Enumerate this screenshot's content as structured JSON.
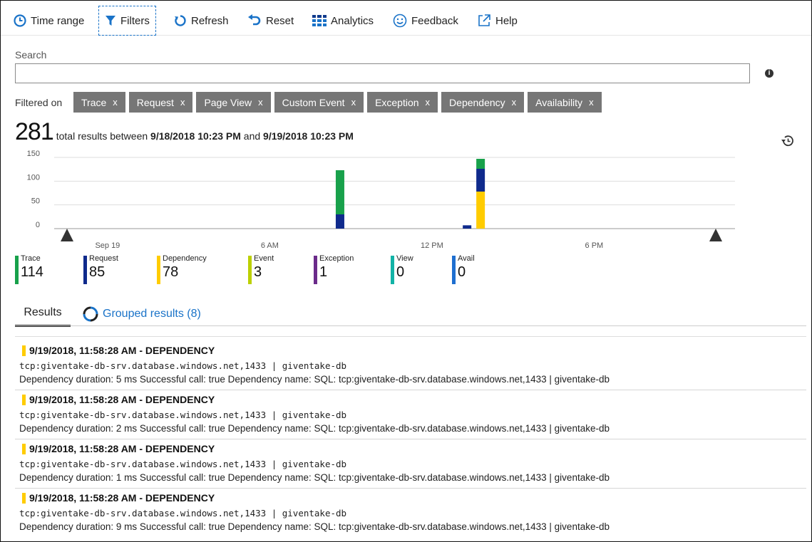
{
  "toolbar": {
    "time_range": "Time range",
    "filters": "Filters",
    "refresh": "Refresh",
    "reset": "Reset",
    "analytics": "Analytics",
    "feedback": "Feedback",
    "help": "Help"
  },
  "search": {
    "label": "Search",
    "value": ""
  },
  "filters": {
    "label": "Filtered on",
    "chips": [
      "Trace",
      "Request",
      "Page View",
      "Custom Event",
      "Exception",
      "Dependency",
      "Availability"
    ],
    "remove_glyph": "x"
  },
  "summary": {
    "count": "281",
    "text_before": "total results between",
    "start": "9/18/2018 10:23 PM",
    "and": "and",
    "end": "9/19/2018 10:23 PM"
  },
  "chart_data": {
    "type": "bar",
    "stacked": true,
    "y_ticks": [
      "150",
      "100",
      "50",
      "0"
    ],
    "ylim": [
      0,
      150
    ],
    "x_labels": [
      "Sep 19",
      "6 AM",
      "12 PM",
      "6 PM"
    ],
    "bars": [
      {
        "time_hours": 8.6,
        "segments": [
          {
            "series": "Request",
            "value": 30
          },
          {
            "series": "Trace",
            "value": 93
          }
        ]
      },
      {
        "time_hours": 13.3,
        "segments": [
          {
            "series": "Request",
            "value": 7
          }
        ]
      },
      {
        "time_hours": 13.8,
        "segments": [
          {
            "series": "Dependency",
            "value": 78
          },
          {
            "series": "Request",
            "value": 48
          },
          {
            "series": "Trace",
            "value": 21
          }
        ]
      }
    ],
    "colors": {
      "Trace": "#18a14b",
      "Request": "#0f2a8c",
      "Dependency": "#ffcc00",
      "Event": "#bcd000",
      "Exception": "#6b2b8a",
      "View": "#12b3a6",
      "Avail": "#1e6fd0"
    }
  },
  "legend": [
    {
      "name": "Trace",
      "value": "114",
      "color": "#18a14b"
    },
    {
      "name": "Request",
      "value": "85",
      "color": "#0f2a8c"
    },
    {
      "name": "Dependency",
      "value": "78",
      "color": "#ffcc00"
    },
    {
      "name": "Event",
      "value": "3",
      "color": "#bcd000"
    },
    {
      "name": "Exception",
      "value": "1",
      "color": "#6b2b8a"
    },
    {
      "name": "View",
      "value": "0",
      "color": "#12b3a6"
    },
    {
      "name": "Avail",
      "value": "0",
      "color": "#1e6fd0"
    }
  ],
  "tabs": {
    "results": "Results",
    "grouped": "Grouped results (8)"
  },
  "results": [
    {
      "title": "9/19/2018, 11:58:28 AM - DEPENDENCY",
      "sub": "tcp:giventake-db-srv.database.windows.net,1433  |  giventake-db",
      "detail": "Dependency duration: 5 ms  Successful call: true  Dependency name: SQL: tcp:giventake-db-srv.database.windows.net,1433 | giventake-db"
    },
    {
      "title": "9/19/2018, 11:58:28 AM - DEPENDENCY",
      "sub": "tcp:giventake-db-srv.database.windows.net,1433  |  giventake-db",
      "detail": "Dependency duration: 2 ms  Successful call: true  Dependency name: SQL: tcp:giventake-db-srv.database.windows.net,1433 | giventake-db"
    },
    {
      "title": "9/19/2018, 11:58:28 AM - DEPENDENCY",
      "sub": "tcp:giventake-db-srv.database.windows.net,1433  |  giventake-db",
      "detail": "Dependency duration: 1 ms  Successful call: true  Dependency name: SQL: tcp:giventake-db-srv.database.windows.net,1433 | giventake-db"
    },
    {
      "title": "9/19/2018, 11:58:28 AM - DEPENDENCY",
      "sub": "tcp:giventake-db-srv.database.windows.net,1433  |  giventake-db",
      "detail": "Dependency duration: 9 ms  Successful call: true  Dependency name: SQL: tcp:giventake-db-srv.database.windows.net,1433 | giventake-db"
    }
  ]
}
